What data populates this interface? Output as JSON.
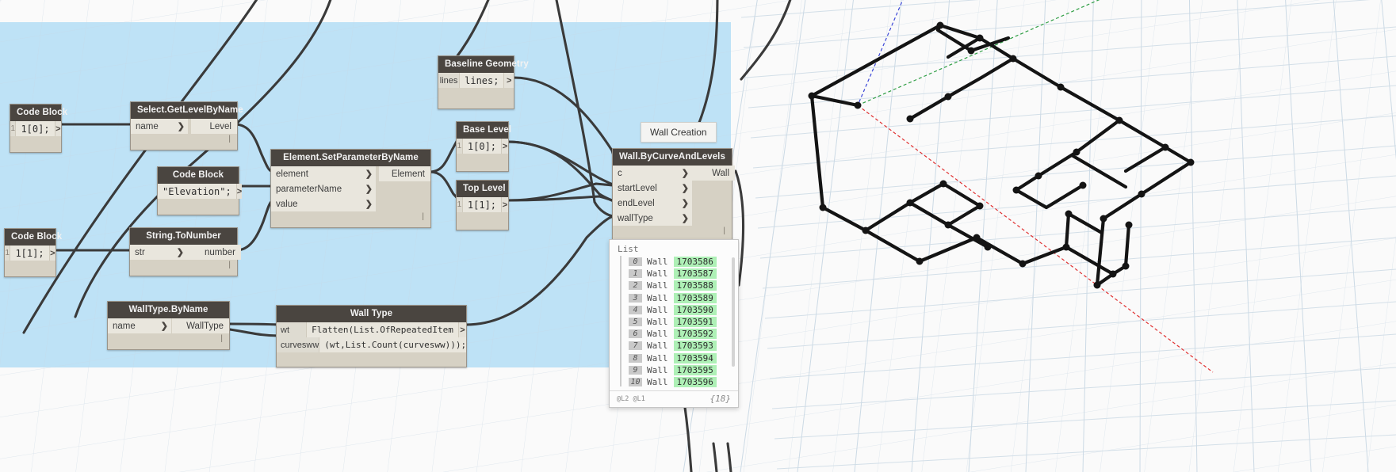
{
  "app": {
    "name": "Dynamo Graph Canvas",
    "selection_color": "#b9e0f5",
    "node_header_color": "#4a4540",
    "node_body_color": "#d6d1c4",
    "wire_color": "#3a3a3a"
  },
  "nodes": [
    {
      "id": "code-block-level-index",
      "title": "Code Block",
      "kind": "code-block",
      "code": "1[0];",
      "gutter": "1",
      "out_chevron": ">"
    },
    {
      "id": "select-getlevelbyname",
      "title": "Select.GetLevelByName",
      "kind": "function",
      "inputs": [
        "name"
      ],
      "outputs": [
        "Level"
      ]
    },
    {
      "id": "code-block-elevation",
      "title": "Code Block",
      "kind": "code-block",
      "code": "\"Elevation\";",
      "gutter": "",
      "out_chevron": ">"
    },
    {
      "id": "element-setparameterbyname",
      "title": "Element.SetParameterByName",
      "kind": "function",
      "inputs": [
        "element",
        "parameterName",
        "value"
      ],
      "outputs": [
        "Element"
      ]
    },
    {
      "id": "code-block-index-1",
      "title": "Code Block",
      "kind": "code-block",
      "code": "1[1];",
      "gutter": "1",
      "out_chevron": ">"
    },
    {
      "id": "string-tonumber",
      "title": "String.ToNumber",
      "kind": "function",
      "inputs": [
        "str"
      ],
      "outputs": [
        "number"
      ]
    },
    {
      "id": "baseline-geometry",
      "title": "Baseline Geometry",
      "kind": "code-block",
      "code": "lines;",
      "gutter": "lines",
      "out_chevron": ">"
    },
    {
      "id": "base-level",
      "title": "Base Level",
      "kind": "code-block",
      "code": "1[0];",
      "gutter": "1",
      "out_chevron": ">"
    },
    {
      "id": "top-level",
      "title": "Top Level",
      "kind": "code-block",
      "code": "1[1];",
      "gutter": "1",
      "out_chevron": ">"
    },
    {
      "id": "walltype-byname",
      "title": "WallType.ByName",
      "kind": "function",
      "inputs": [
        "name"
      ],
      "outputs": [
        "WallType"
      ]
    },
    {
      "id": "wall-type",
      "title": "Wall Type",
      "kind": "code-block-multi",
      "inputs": [
        "wt",
        "curvesww"
      ],
      "code_line_1": "Flatten(List.OfRepeatedItem",
      "code_line_2": "(wt,List.Count(curvesww)));",
      "out_chevron": ">"
    },
    {
      "id": "wall-bycurveandlevels",
      "title": "Wall.ByCurveAndLevels",
      "kind": "function",
      "inputs": [
        "c",
        "startLevel",
        "endLevel",
        "wallType"
      ],
      "outputs": [
        "Wall"
      ]
    }
  ],
  "annotations": [
    {
      "id": "wall-creation-note",
      "text": "Wall Creation"
    }
  ],
  "preview": {
    "title": "List",
    "type_label": "Wall",
    "rows": [
      {
        "index": "0",
        "type": "Wall",
        "id": "1703586"
      },
      {
        "index": "1",
        "type": "Wall",
        "id": "1703587"
      },
      {
        "index": "2",
        "type": "Wall",
        "id": "1703588"
      },
      {
        "index": "3",
        "type": "Wall",
        "id": "1703589"
      },
      {
        "index": "4",
        "type": "Wall",
        "id": "1703590"
      },
      {
        "index": "5",
        "type": "Wall",
        "id": "1703591"
      },
      {
        "index": "6",
        "type": "Wall",
        "id": "1703592"
      },
      {
        "index": "7",
        "type": "Wall",
        "id": "1703593"
      },
      {
        "index": "8",
        "type": "Wall",
        "id": "1703594"
      },
      {
        "index": "9",
        "type": "Wall",
        "id": "1703595"
      },
      {
        "index": "10",
        "type": "Wall",
        "id": "1703596"
      }
    ],
    "footer_left": "@L2 @L1",
    "footer_count": "{18}",
    "id_highlight_color": "#aef0b6"
  },
  "viewport": {
    "name": "3d-preview",
    "background": "#f7f7f7",
    "grid_color": "#d8e2ea",
    "geometry_color": "#141414",
    "axis_x_color": "#e03030",
    "axis_y_color": "#2f9e44",
    "axis_z_color": "#3b46d8"
  }
}
